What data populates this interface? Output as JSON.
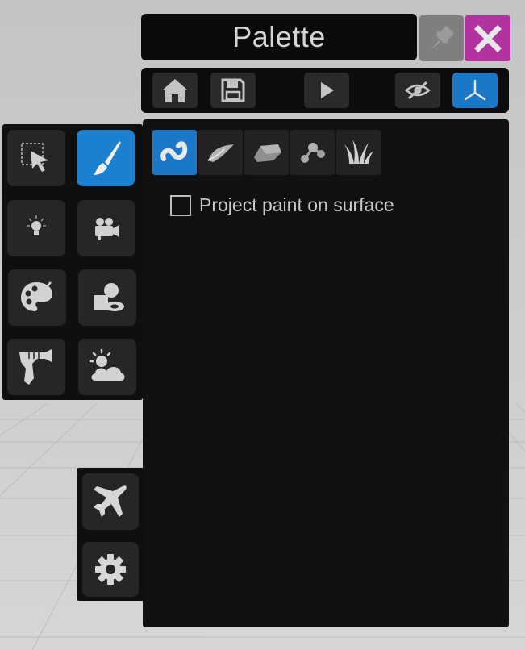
{
  "window": {
    "title": "Palette"
  },
  "header_buttons": {
    "pin": {
      "icon": "pin-icon",
      "color": "#7f7f7f"
    },
    "close": {
      "icon": "close-icon",
      "color": "#b2329f"
    }
  },
  "toolbar": {
    "buttons": [
      {
        "icon": "home-icon",
        "active": false
      },
      {
        "icon": "save-icon",
        "active": false
      },
      {
        "icon": "play-icon",
        "active": false
      },
      {
        "icon": "hide-icon",
        "active": false
      },
      {
        "icon": "axis-icon",
        "active": true
      }
    ]
  },
  "paint": {
    "subtabs": [
      {
        "icon": "tube-stroke-icon",
        "active": true
      },
      {
        "icon": "ribbon-stroke-icon",
        "active": false
      },
      {
        "icon": "volume-stroke-icon",
        "active": false
      },
      {
        "icon": "nodes-stroke-icon",
        "active": false
      },
      {
        "icon": "grass-stroke-icon",
        "active": false
      }
    ],
    "project_on_surface": {
      "label": "Project paint on surface",
      "checked": false
    }
  },
  "tools": [
    {
      "icon": "selection-icon",
      "active": false
    },
    {
      "icon": "paint-brush-icon",
      "active": true
    },
    {
      "icon": "light-icon",
      "active": false
    },
    {
      "icon": "camera-icon",
      "active": false
    },
    {
      "icon": "palette-icon",
      "active": false
    },
    {
      "icon": "primitives-icon",
      "active": false
    },
    {
      "icon": "ray-gun-icon",
      "active": false
    },
    {
      "icon": "weather-icon",
      "active": false
    }
  ],
  "bottom_tools": [
    {
      "icon": "airplane-icon",
      "active": false
    },
    {
      "icon": "settings-gear-icon",
      "active": false
    }
  ],
  "colors": {
    "accent": "#1b78c8",
    "close": "#b2329f",
    "panel": "#111111",
    "button": "#262626",
    "icon": "#c4c4c4"
  }
}
